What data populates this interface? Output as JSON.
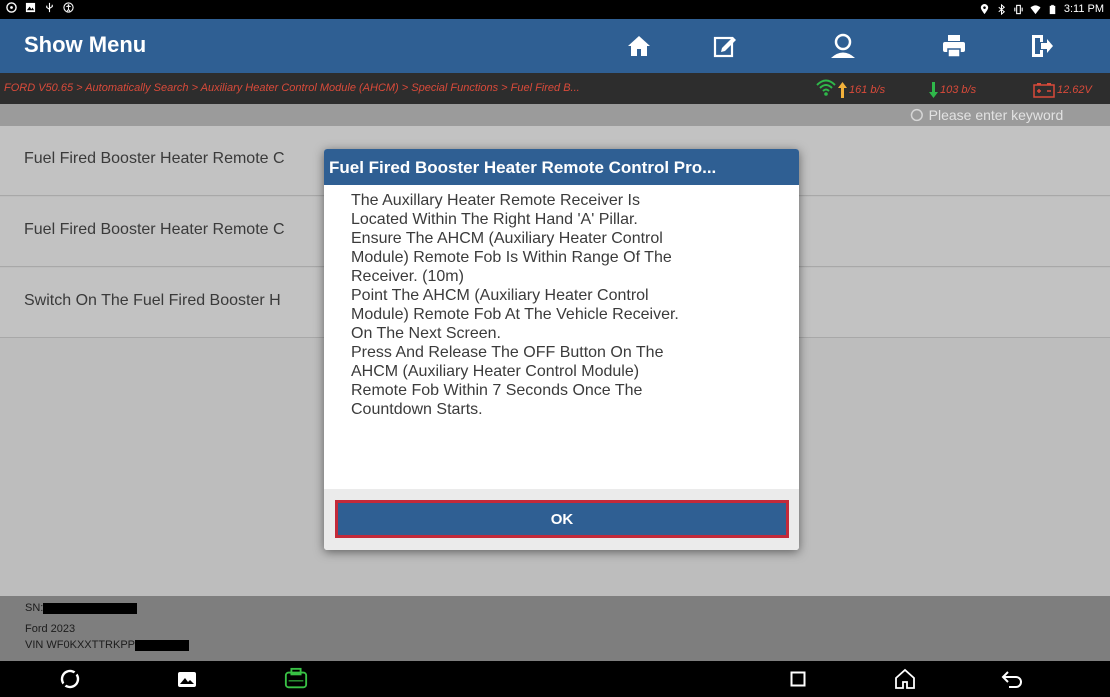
{
  "status_bar": {
    "time": "3:11 PM",
    "left_icons": [
      "message-icon",
      "image-icon",
      "usb-icon",
      "accessibility-icon"
    ],
    "right_icons": [
      "location-icon",
      "bluetooth-icon",
      "vibrate-icon",
      "wifi-icon",
      "battery-icon"
    ]
  },
  "header": {
    "title": "Show Menu",
    "buttons": [
      "home-icon",
      "edit-report-icon",
      "user-icon",
      "print-icon",
      "exit-icon"
    ]
  },
  "breadcrumb": {
    "text": "FORD V50.65 > Automatically Search > Auxiliary Heater Control Module (AHCM) > Special Functions > Fuel Fired B...",
    "upload_rate": "161 b/s",
    "download_rate": "103 b/s",
    "voltage": "12.62V"
  },
  "search": {
    "placeholder": "Please enter keyword"
  },
  "list": {
    "items": [
      "Fuel Fired Booster Heater Remote C",
      "Fuel Fired Booster Heater Remote C",
      "Switch On The Fuel Fired Booster H"
    ]
  },
  "footer": {
    "sn_label": "SN:",
    "vehicle": "Ford  2023",
    "vin_label": "VIN WF0KXXTTRKPP"
  },
  "dialog": {
    "title": "Fuel Fired Booster Heater Remote Control Pro...",
    "lines": [
      "The Auxillary Heater Remote Receiver Is",
      "Located Within The Right Hand 'A' Pillar.",
      "Ensure The AHCM (Auxiliary Heater Control",
      "Module) Remote Fob Is Within Range Of The",
      "Receiver. (10m)",
      "Point The AHCM (Auxiliary Heater Control",
      "Module) Remote Fob At The Vehicle Receiver.",
      "On The Next Screen.",
      "Press And Release The OFF Button On The",
      "AHCM (Auxiliary Heater Control Module)",
      "Remote Fob Within 7 Seconds Once The",
      "Countdown Starts."
    ],
    "ok_label": "OK"
  },
  "nav_bar": {
    "icons": [
      "browser-icon",
      "gallery-icon",
      "vci-icon",
      "recents-icon",
      "home-icon",
      "back-icon"
    ]
  },
  "colors": {
    "header_blue": "#2f5f93",
    "accent_red": "#d94a3a",
    "highlight_red": "#c32a3a"
  }
}
